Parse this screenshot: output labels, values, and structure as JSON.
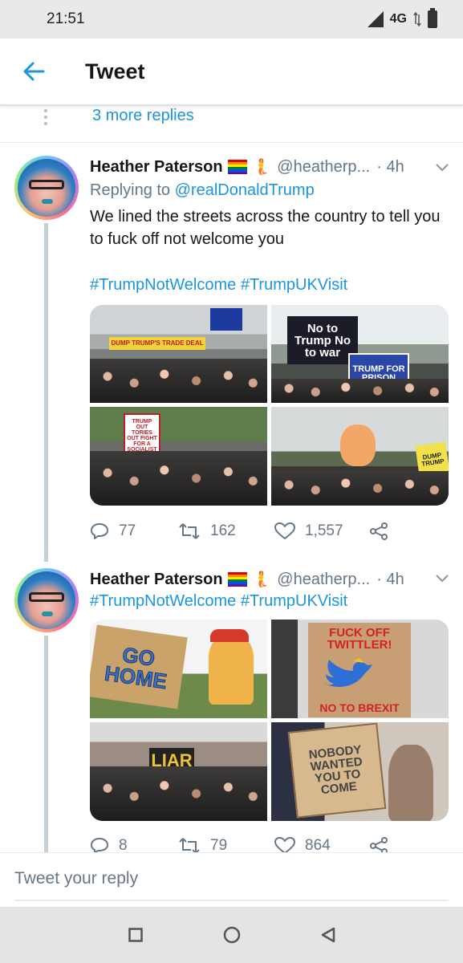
{
  "status_bar": {
    "time": "21:51",
    "network": "4G"
  },
  "header": {
    "title": "Tweet"
  },
  "more_replies": {
    "label": "3 more replies"
  },
  "tweets": [
    {
      "name": "Heather Paterson",
      "handle": "@heatherp...",
      "time": "· 4h",
      "replying_prefix": "Replying to ",
      "replying_to": "@realDonaldTrump",
      "text": "We lined the streets across the country to tell you to fuck off not welcome you",
      "hashtags": "#TrumpNotWelcome #TrumpUKVisit",
      "photos": [
        {
          "sign": "DUMP TRUMP'S TRADE DEAL"
        },
        {
          "sign": "No to Trump No to war",
          "sign2": "TRUMP FOR PRISON"
        },
        {
          "sign": "TRUMP OUT TORIES OUT FIGHT FOR A SOCIALIST FUTURE"
        },
        {
          "sign": "DUMP TRUMP"
        }
      ],
      "replies": "77",
      "retweets": "162",
      "likes": "1,557"
    },
    {
      "name": "Heather Paterson",
      "handle": "@heatherp...",
      "time": "· 4h",
      "hashtags": "#TrumpNotWelcome #TrumpUKVisit",
      "photos": [
        {
          "sign": "GO HOME"
        },
        {
          "sign": "FUCK OFF TWITTLER!",
          "sign2": "NO TO BREXIT"
        },
        {
          "sign": "LIAR"
        },
        {
          "sign": "NOBODY WANTED YOU TO COME"
        }
      ],
      "replies": "8",
      "retweets": "79",
      "likes": "864"
    }
  ],
  "reply_bar": {
    "placeholder": "Tweet your reply"
  },
  "colors": {
    "link": "#1b95e0",
    "muted": "#657786",
    "text": "#14171a"
  }
}
